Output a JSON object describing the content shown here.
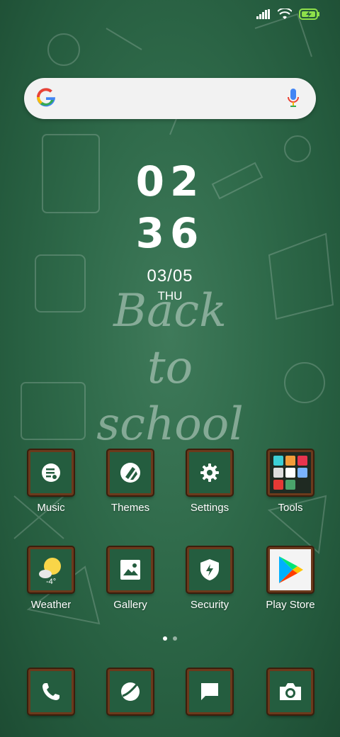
{
  "clock": {
    "hours": "02",
    "minutes": "36",
    "date": "03/05",
    "day": "THU"
  },
  "wallpaper_text": {
    "line1": "Back",
    "line2": "to",
    "line3": "school"
  },
  "search": {
    "provider_icon": "google-g-icon",
    "mic_icon": "mic-icon"
  },
  "apps_row1": [
    {
      "label": "Music",
      "icon": "music-icon"
    },
    {
      "label": "Themes",
      "icon": "themes-icon"
    },
    {
      "label": "Settings",
      "icon": "gear-icon"
    },
    {
      "label": "Tools",
      "icon": "folder-icon"
    }
  ],
  "apps_row2": [
    {
      "label": "Weather",
      "icon": "sun-cloud-icon",
      "temp": "-4°"
    },
    {
      "label": "Gallery",
      "icon": "image-icon"
    },
    {
      "label": "Security",
      "icon": "shield-icon"
    },
    {
      "label": "Play Store",
      "icon": "play-store-icon"
    }
  ],
  "dock": [
    {
      "icon": "phone-icon"
    },
    {
      "icon": "browser-icon"
    },
    {
      "icon": "message-icon"
    },
    {
      "icon": "camera-icon"
    }
  ],
  "page_indicator": {
    "pages": 2,
    "current": 1
  },
  "colors": {
    "board": "#2f6a4a",
    "frame": "#6b3a1c",
    "accent": "#ffffff"
  }
}
